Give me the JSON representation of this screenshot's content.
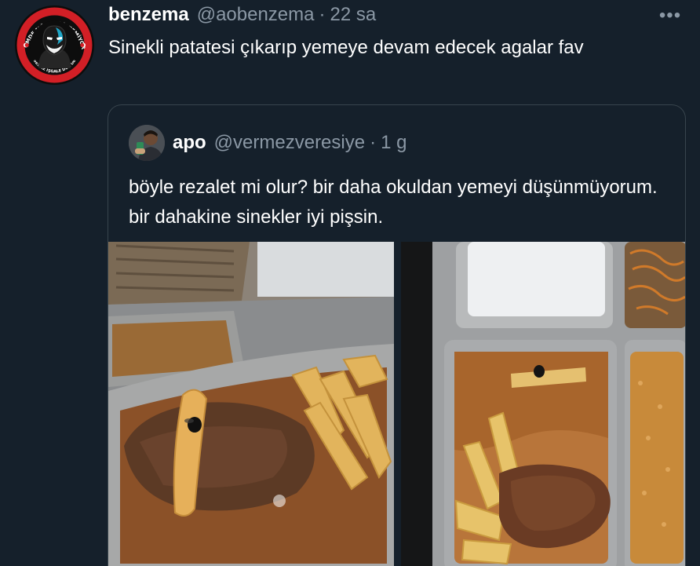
{
  "tweet": {
    "author_name": "benzema",
    "author_handle": "@aobenzema",
    "separator": "·",
    "time": "22 sa",
    "more_icon": "•••",
    "text": "Sinekli patatesi çıkarıp yemeye devam edecek agalar fav",
    "avatar_ring_text": "ÜLKEMDE MÜLTECİ İSTEMİYORUM",
    "avatar_bottom_text": "SESSİZ İŞGALE DUR DE"
  },
  "quoted_tweet": {
    "author_name": "apo",
    "author_handle": "@vermezveresiye",
    "separator": "·",
    "time": "1 g",
    "text": "böyle rezalet mi olur? bir daha okuldan yemeyi düşünmüyorum. bir dahakine sinekler iyi pişsin."
  },
  "colors": {
    "background": "#15202b",
    "border": "#38444d",
    "secondary_text": "#8b98a5",
    "avatar_red": "#d21f26"
  },
  "icons": {
    "more": "more-options-icon",
    "avatar": "masked-face-logo"
  }
}
